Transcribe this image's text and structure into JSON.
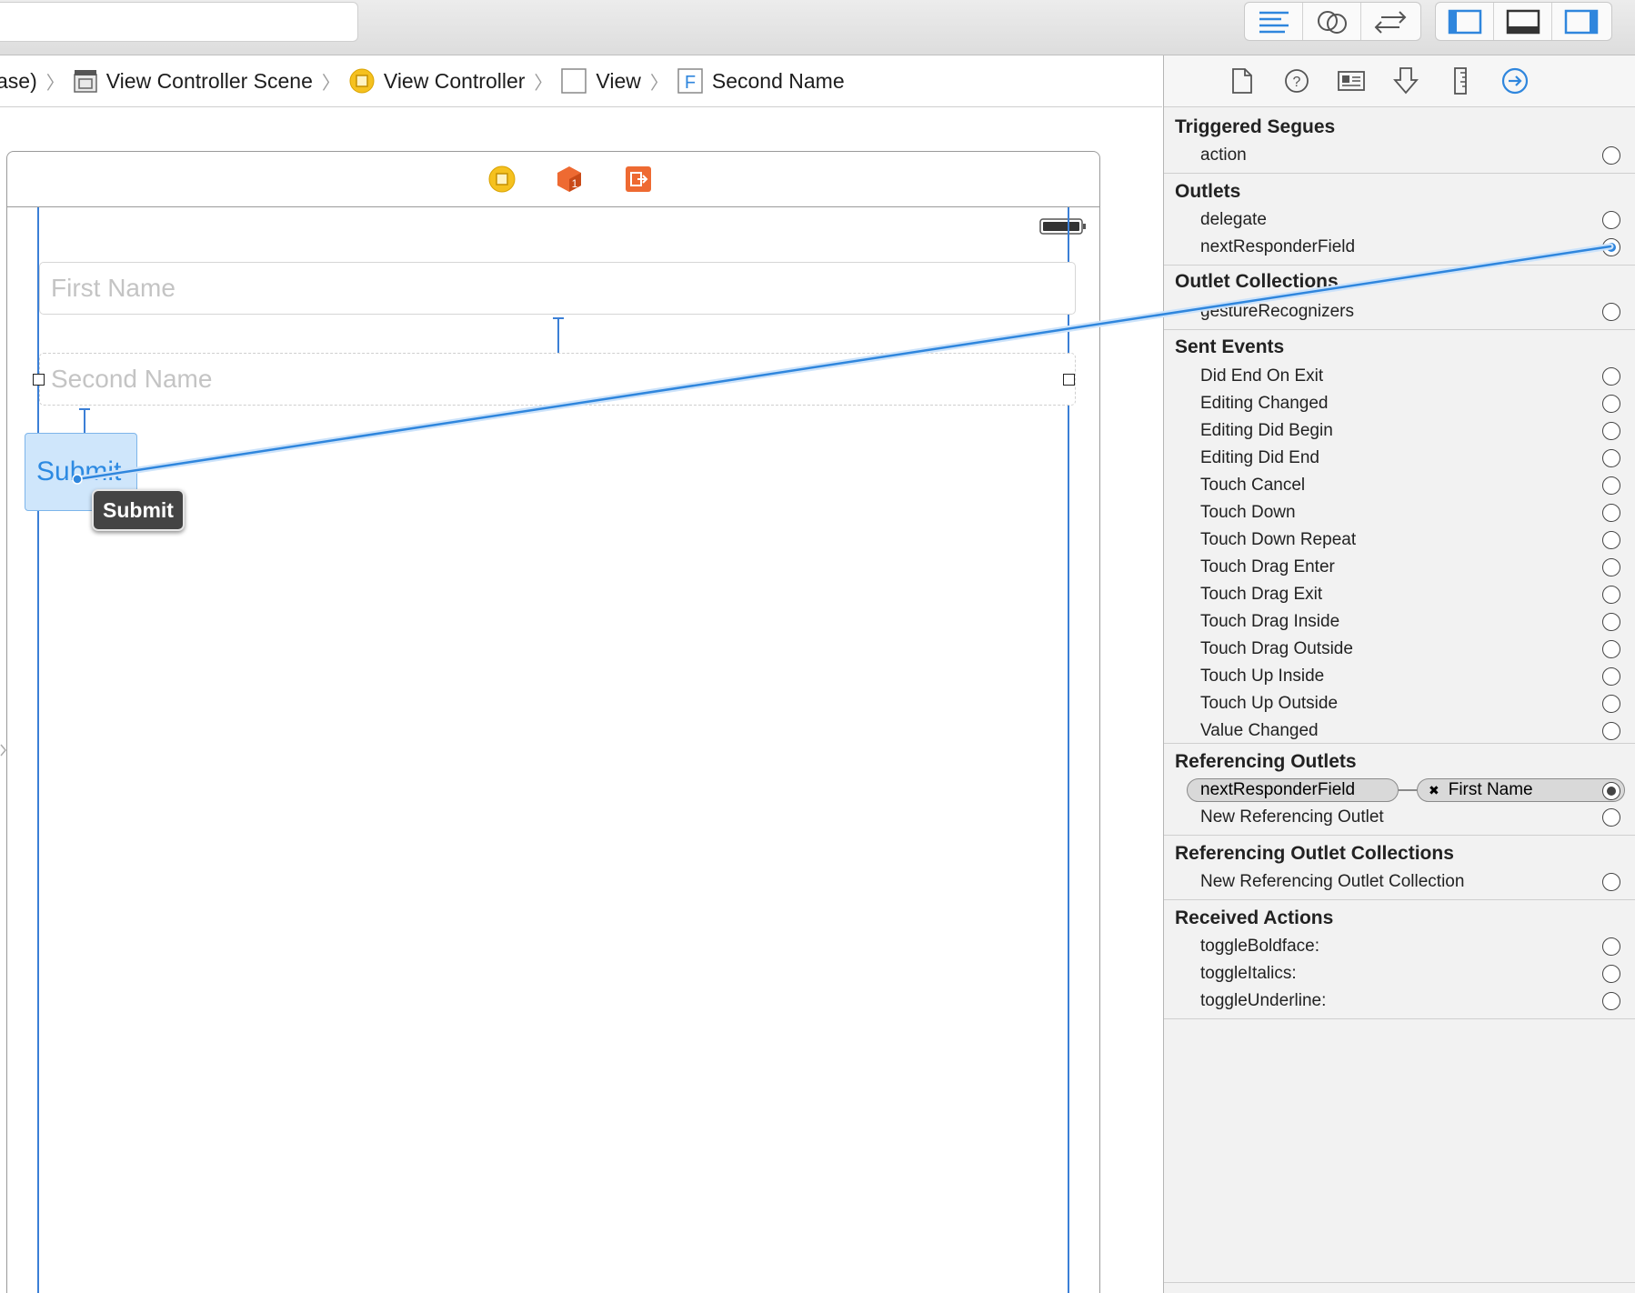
{
  "toolbar": {
    "editor_buttons": [
      "standard-editor-icon",
      "assistant-editor-icon",
      "version-editor-icon"
    ],
    "view_buttons": [
      "navigator-toggle-icon",
      "debug-area-toggle-icon",
      "utilities-toggle-icon"
    ]
  },
  "breadcrumb": {
    "items": [
      {
        "label": "ase)",
        "icon": ""
      },
      {
        "label": "View Controller Scene",
        "icon": "scene-icon"
      },
      {
        "label": "View Controller",
        "icon": "view-controller-icon"
      },
      {
        "label": "View",
        "icon": "view-icon"
      },
      {
        "label": "Second Name",
        "icon": "text-field-icon",
        "icon_glyph": "F"
      }
    ]
  },
  "scene": {
    "dock_icons": [
      "view-controller-icon",
      "first-responder-icon",
      "exit-icon"
    ],
    "first_name_placeholder": "First Name",
    "second_name_placeholder": "Second Name",
    "submit_label": "Submit",
    "tooltip": "Submit"
  },
  "inspector": {
    "tabs": [
      "file-inspector-icon",
      "quick-help-icon",
      "identity-inspector-icon",
      "attributes-inspector-icon",
      "size-inspector-icon",
      "connections-inspector-icon"
    ],
    "active_tab": "connections-inspector-icon",
    "accent": "#2f86dd",
    "sections": [
      {
        "title": "Triggered Segues",
        "rows": [
          {
            "label": "action",
            "connected": false
          }
        ]
      },
      {
        "title": "Outlets",
        "rows": [
          {
            "label": "delegate",
            "connected": false
          },
          {
            "label": "nextResponderField",
            "connected": true
          }
        ]
      },
      {
        "title": "Outlet Collections",
        "rows": [
          {
            "label": "gestureRecognizers",
            "connected": false
          }
        ]
      },
      {
        "title": "Sent Events",
        "rows": [
          {
            "label": "Did End On Exit",
            "connected": false
          },
          {
            "label": "Editing Changed",
            "connected": false
          },
          {
            "label": "Editing Did Begin",
            "connected": false
          },
          {
            "label": "Editing Did End",
            "connected": false
          },
          {
            "label": "Touch Cancel",
            "connected": false
          },
          {
            "label": "Touch Down",
            "connected": false
          },
          {
            "label": "Touch Down Repeat",
            "connected": false
          },
          {
            "label": "Touch Drag Enter",
            "connected": false
          },
          {
            "label": "Touch Drag Exit",
            "connected": false
          },
          {
            "label": "Touch Drag Inside",
            "connected": false
          },
          {
            "label": "Touch Drag Outside",
            "connected": false
          },
          {
            "label": "Touch Up Inside",
            "connected": false
          },
          {
            "label": "Touch Up Outside",
            "connected": false
          },
          {
            "label": "Value Changed",
            "connected": false
          }
        ]
      },
      {
        "title": "Referencing Outlets",
        "connection": {
          "outlet": "nextResponderField",
          "target": "First Name",
          "remove_glyph": "✖"
        },
        "rows": [
          {
            "label": "New Referencing Outlet",
            "connected": false
          }
        ]
      },
      {
        "title": "Referencing Outlet Collections",
        "rows": [
          {
            "label": "New Referencing Outlet Collection",
            "connected": false
          }
        ]
      },
      {
        "title": "Received Actions",
        "rows": [
          {
            "label": "toggleBoldface:",
            "connected": false
          },
          {
            "label": "toggleItalics:",
            "connected": false
          },
          {
            "label": "toggleUnderline:",
            "connected": false
          }
        ]
      }
    ]
  }
}
